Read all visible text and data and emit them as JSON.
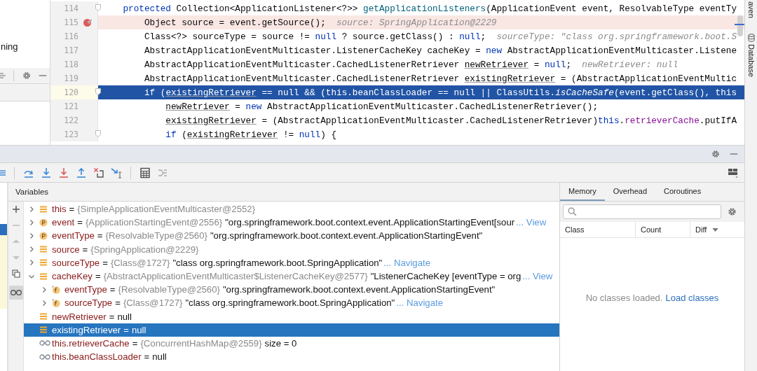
{
  "project_panel": {
    "label": "ning"
  },
  "editor": {
    "lines": [
      {
        "number": "114",
        "breakpoint": false,
        "current": false,
        "fold": true,
        "segments": [
          {
            "text": "protected",
            "kind": "keyword"
          },
          {
            "text": " Collection<ApplicationListener<?>> ",
            "kind": "plain"
          },
          {
            "text": "getApplicationListeners",
            "kind": "method"
          },
          {
            "text": "(ApplicationEvent event, ResolvableType eventTy",
            "kind": "plain"
          }
        ],
        "children": [
          {
            "number": "115",
            "breakpoint": true,
            "current": false,
            "fold": false,
            "segments": [
              {
                "text": "Object source = event.getSource();",
                "kind": "plain"
              }
            ],
            "hint": "source: SpringApplication@2229"
          },
          {
            "number": "116",
            "breakpoint": false,
            "current": false,
            "fold": false,
            "segments": [
              {
                "text": "Class<?> sourceType = source != ",
                "kind": "plain"
              },
              {
                "text": "null",
                "kind": "keyword"
              },
              {
                "text": " ? source.getClass() : ",
                "kind": "plain"
              },
              {
                "text": "null",
                "kind": "keyword"
              },
              {
                "text": ";",
                "kind": "plain"
              }
            ],
            "hint": "sourceType: \"class org.springframework.boot.S"
          },
          {
            "number": "117",
            "breakpoint": false,
            "current": false,
            "fold": false,
            "segments": [
              {
                "text": "AbstractApplicationEventMulticaster.ListenerCacheKey cacheKey = ",
                "kind": "plain"
              },
              {
                "text": "new",
                "kind": "keyword"
              },
              {
                "text": " AbstractApplicationEventMulticaster.Listene",
                "kind": "plain"
              }
            ]
          },
          {
            "number": "118",
            "breakpoint": false,
            "current": false,
            "fold": false,
            "segments": [
              {
                "text": "AbstractApplicationEventMulticaster.CachedListenerRetriever ",
                "kind": "plain"
              },
              {
                "text": "newRetriever",
                "kind": "reassigned"
              },
              {
                "text": " = ",
                "kind": "plain"
              },
              {
                "text": "null",
                "kind": "keyword"
              },
              {
                "text": ";",
                "kind": "plain"
              }
            ],
            "hint": "newRetriever: null"
          },
          {
            "number": "119",
            "breakpoint": false,
            "current": false,
            "fold": false,
            "segments": [
              {
                "text": "AbstractApplicationEventMulticaster.CachedListenerRetriever ",
                "kind": "plain"
              },
              {
                "text": "existingRetriever",
                "kind": "reassigned"
              },
              {
                "text": " = (AbstractApplicationEventMultic",
                "kind": "plain"
              }
            ]
          },
          {
            "number": "120",
            "breakpoint": false,
            "current": true,
            "fold": true,
            "segments": [
              {
                "text": "if (",
                "kind": "plain"
              },
              {
                "text": "existingRetriever",
                "kind": "reassigned"
              },
              {
                "text": " == null && (this.beanClassLoader == null || ClassUtils.",
                "kind": "plain"
              },
              {
                "text": "isCacheSafe",
                "kind": "static"
              },
              {
                "text": "(event.getClass(), this",
                "kind": "plain"
              }
            ],
            "children": [
              {
                "number": "121",
                "breakpoint": false,
                "current": false,
                "fold": false,
                "segments": [
                  {
                    "text": "newRetriever",
                    "kind": "reassigned"
                  },
                  {
                    "text": " = ",
                    "kind": "plain"
                  },
                  {
                    "text": "new",
                    "kind": "keyword"
                  },
                  {
                    "text": " AbstractApplicationEventMulticaster.CachedListenerRetriever();",
                    "kind": "plain"
                  }
                ]
              },
              {
                "number": "122",
                "breakpoint": false,
                "current": false,
                "fold": false,
                "segments": [
                  {
                    "text": "existingRetriever",
                    "kind": "reassigned"
                  },
                  {
                    "text": " = (AbstractApplicationEventMulticaster.CachedListenerRetriever)",
                    "kind": "plain"
                  },
                  {
                    "text": "this",
                    "kind": "keyword"
                  },
                  {
                    "text": ".",
                    "kind": "plain"
                  },
                  {
                    "text": "retrieverCache",
                    "kind": "field"
                  },
                  {
                    "text": ".putIfA",
                    "kind": "plain"
                  }
                ]
              },
              {
                "number": "123",
                "breakpoint": false,
                "current": false,
                "fold": true,
                "segments": [
                  {
                    "text": "if",
                    "kind": "keyword"
                  },
                  {
                    "text": " (",
                    "kind": "plain"
                  },
                  {
                    "text": "existingRetriever",
                    "kind": "reassigned"
                  },
                  {
                    "text": " != ",
                    "kind": "plain"
                  },
                  {
                    "text": "null",
                    "kind": "keyword"
                  },
                  {
                    "text": ") {",
                    "kind": "plain"
                  }
                ]
              }
            ]
          }
        ]
      }
    ]
  },
  "right_tool_strip": [
    {
      "label": "aven",
      "kind": "plain"
    },
    {
      "label": "Database",
      "kind": "database"
    }
  ],
  "debugger": {
    "variables_title": "Variables",
    "variables": [
      {
        "kind": "field",
        "expanded": false,
        "selected": false,
        "name": "this",
        "sign": "=",
        "type": "{SimpleApplicationEventMulticaster@2552}"
      },
      {
        "kind": "param",
        "expanded": false,
        "selected": false,
        "name": "event",
        "sign": "=",
        "type": "{ApplicationStartingEvent@2556}",
        "value": "\"org.springframework.boot.context.event.ApplicationStartingEvent[sour",
        "link": "... View"
      },
      {
        "kind": "param",
        "expanded": false,
        "selected": false,
        "name": "eventType",
        "sign": "=",
        "type": "{ResolvableType@2560}",
        "value": "\"org.springframework.boot.context.event.ApplicationStartingEvent\""
      },
      {
        "kind": "field",
        "expanded": false,
        "selected": false,
        "name": "source",
        "sign": "=",
        "type": "{SpringApplication@2229}"
      },
      {
        "kind": "field",
        "expanded": false,
        "selected": false,
        "name": "sourceType",
        "sign": "=",
        "type": "{Class@1727}",
        "value": "\"class org.springframework.boot.SpringApplication\"",
        "link": "... Navigate"
      },
      {
        "kind": "field",
        "expanded": true,
        "selected": false,
        "name": "cacheKey",
        "sign": "=",
        "type": "{AbstractApplicationEventMulticaster$ListenerCacheKey@2577}",
        "value": "\"ListenerCacheKey [eventType = org",
        "link": "... View",
        "children": [
          {
            "kind": "final_field",
            "expanded": false,
            "selected": false,
            "name": "eventType",
            "sign": "=",
            "type": "{ResolvableType@2560}",
            "value": "\"org.springframework.boot.context.event.ApplicationStartingEvent\""
          },
          {
            "kind": "final_field",
            "expanded": false,
            "selected": false,
            "name": "sourceType",
            "sign": "=",
            "type": "{Class@1727}",
            "value": "\"class org.springframework.boot.SpringApplication\"",
            "link": "... Navigate"
          }
        ]
      },
      {
        "kind": "field",
        "selected": false,
        "name": "newRetriever",
        "sign": "=",
        "value": "null"
      },
      {
        "kind": "field",
        "selected": true,
        "name": "existingRetriever",
        "sign": "=",
        "value": "null"
      },
      {
        "kind": "watch",
        "selected": false,
        "name": "this.retrieverCache",
        "sign": "=",
        "type": "{ConcurrentHashMap@2559}",
        "value": "size = 0"
      },
      {
        "kind": "watch",
        "selected": false,
        "name": "this.beanClassLoader",
        "sign": "=",
        "value": "null"
      }
    ]
  },
  "memory": {
    "tabs": [
      {
        "label": "Memory",
        "selected": true
      },
      {
        "label": "Overhead",
        "selected": false
      },
      {
        "label": "Coroutines",
        "selected": false
      }
    ],
    "columns": [
      {
        "label": "Class",
        "sort": false
      },
      {
        "label": "Count",
        "sort": false
      },
      {
        "label": "Diff",
        "sort": true
      }
    ],
    "empty_message": "No classes loaded.",
    "load_link": "Load classes"
  }
}
